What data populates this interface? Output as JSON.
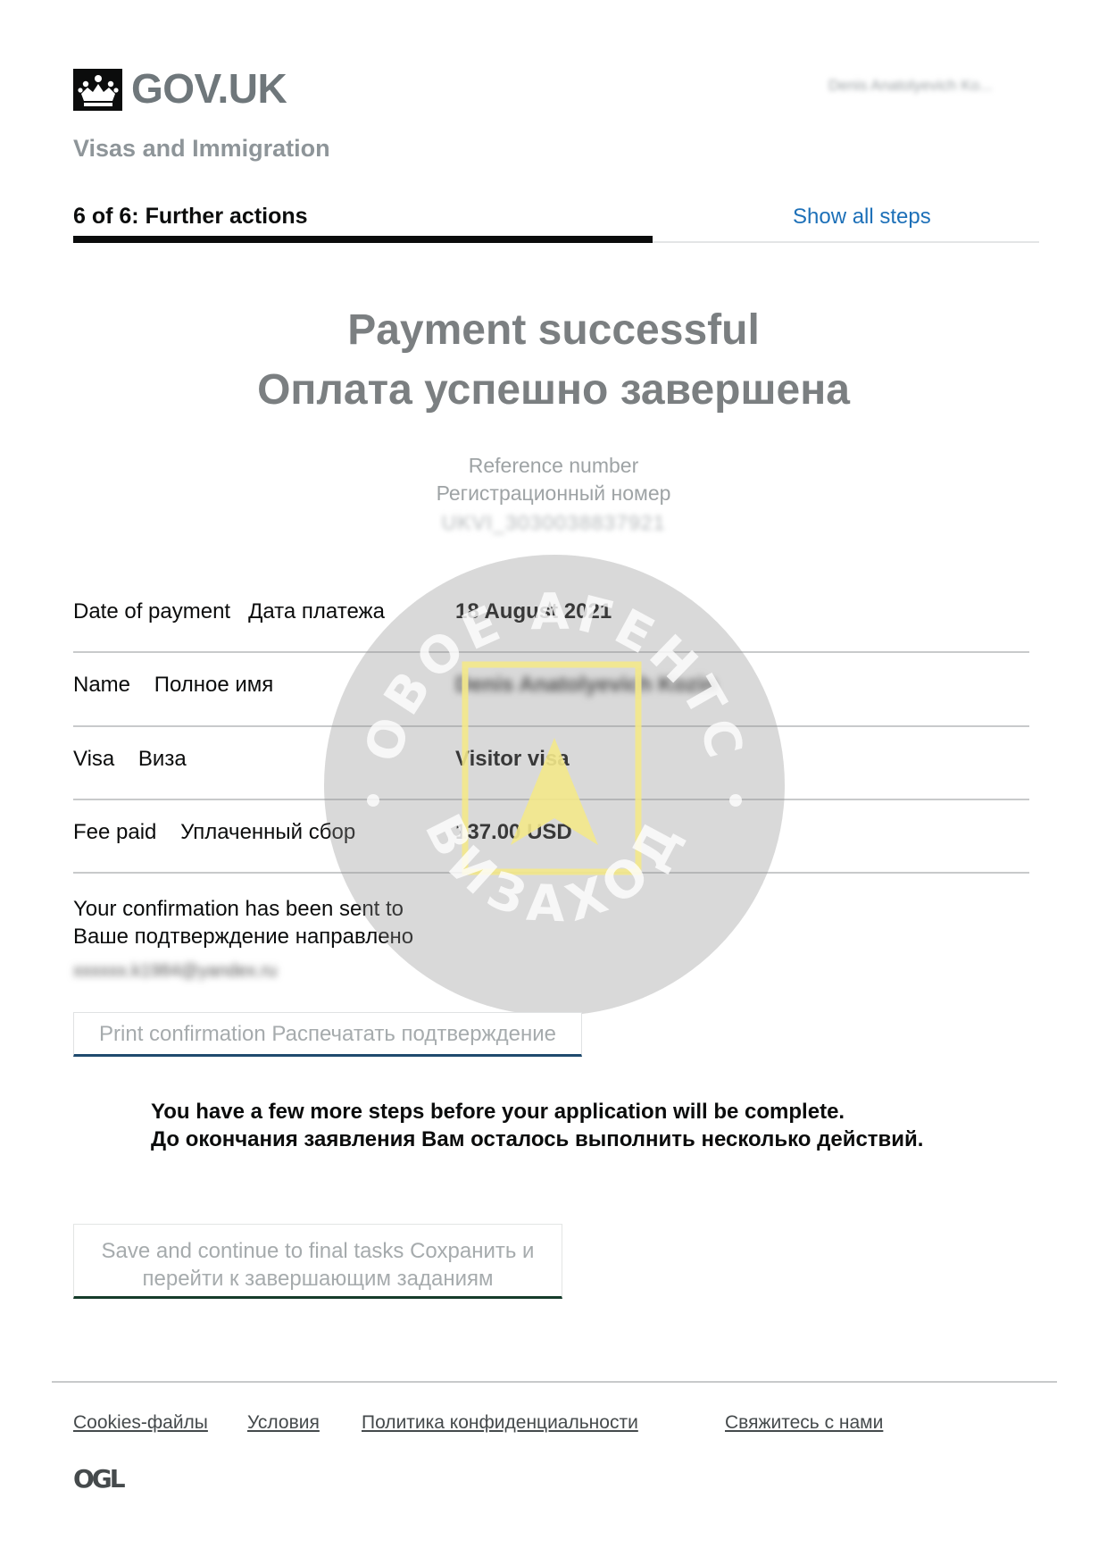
{
  "header": {
    "brand": "GOV.UK",
    "user_name": "Denis Anatolyevich Ko...",
    "service_name": "Visas and Immigration",
    "crown_icon": "crown-icon"
  },
  "progress": {
    "step_label": "6 of 6: Further actions",
    "show_all_steps": "Show all steps",
    "fraction": 0.6
  },
  "result": {
    "title_en": "Payment successful",
    "title_ru": "Оплата успешно завершена",
    "reference_label_en": "Reference number",
    "reference_label_ru": "Регистрационный номер",
    "reference_value": "UKVI_3030038837921"
  },
  "stamp": {
    "text_top": "ВИЗОВОЕ АГЕНТСТВО",
    "text_bottom": "ВИЗАХОД"
  },
  "summary": [
    {
      "key": "Date of payment   Дата платежа",
      "value": "18 August 2021",
      "blurred": false
    },
    {
      "key": "Name    Полное имя",
      "value": "Denis Anatolyevich Kozin",
      "blurred": true
    },
    {
      "key": "Visa    Виза",
      "value": "Visitor visa",
      "blurred": false
    },
    {
      "key": "Fee paid    Уплаченный сбор",
      "value": "137.00 USD",
      "blurred": false
    }
  ],
  "confirmation": {
    "line_en": "Your confirmation has been sent to",
    "line_ru": "Ваше подтверждение направлено",
    "email": "xxxxxx.k1984@yandex.ru"
  },
  "buttons": {
    "print": "Print confirmation Распечатать подтверждение",
    "save_line1": "Save and continue to final tasks Сохранить и",
    "save_line2": "перейти к завершающим заданиям"
  },
  "notice": {
    "line_en": "You have a few more steps before your application will be complete.",
    "line_ru": "До окончания заявления Вам осталось выполнить несколько действий."
  },
  "footer": {
    "links": [
      "Cookies-файлы",
      "Условия",
      "Политика конфиденциальности",
      "Свяжитесь с нами"
    ],
    "ogl": "OGL"
  },
  "colors": {
    "link": "#1d70b8",
    "text": "#0b0c0c",
    "stamp_gray": "#8f8f8f",
    "stamp_arrow": "#f3e88a"
  }
}
